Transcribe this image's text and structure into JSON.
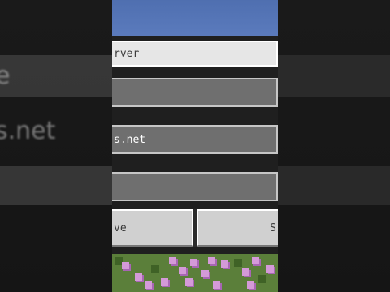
{
  "left_side": {
    "ghost_lines": [
      "e",
      "s.net"
    ]
  },
  "dialog": {
    "server_name_label": "rver",
    "server_address_value": "s.net",
    "left_button_label": "ve",
    "right_button_label": "S"
  },
  "colors": {
    "sky": "#5b7bbd",
    "field_bg": "#6f6f6f",
    "label_bg": "#e6e6e6",
    "button_bg": "#d0d0d0",
    "grass": "#5b7f3a",
    "flower": "#d49ad8"
  },
  "icons": {
    "flowers": "flower-tile-icon"
  }
}
